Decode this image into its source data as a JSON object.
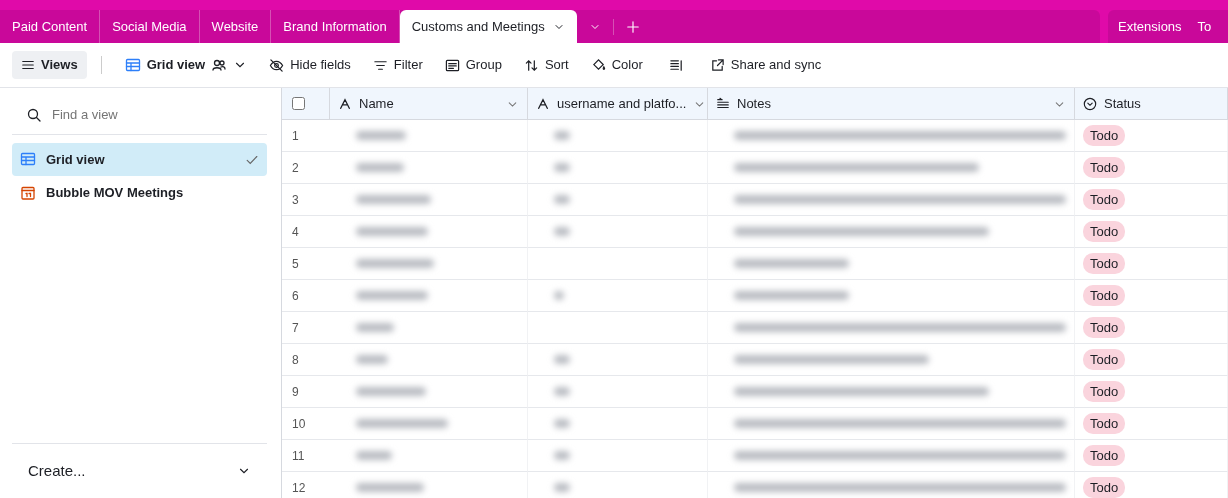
{
  "tabs": [
    {
      "label": "Paid Content",
      "selected": false
    },
    {
      "label": "Social Media",
      "selected": false
    },
    {
      "label": "Website",
      "selected": false
    },
    {
      "label": "Brand Information",
      "selected": false
    },
    {
      "label": "Customs and Meetings",
      "selected": true
    }
  ],
  "top_right": [
    "Extensions",
    "To"
  ],
  "toolbar": {
    "views": "Views",
    "view_name": "Grid view",
    "buttons": [
      {
        "kind": "hide",
        "label": "Hide fields"
      },
      {
        "kind": "filter",
        "label": "Filter"
      },
      {
        "kind": "group",
        "label": "Group"
      },
      {
        "kind": "sort",
        "label": "Sort"
      },
      {
        "kind": "color",
        "label": "Color"
      },
      {
        "kind": "rowheight"
      },
      {
        "kind": "share",
        "label": "Share and sync"
      }
    ]
  },
  "sidebar": {
    "search": {
      "placeholder": "Find a view"
    },
    "items": [
      {
        "kind": "grid",
        "label": "Grid view",
        "selected": true
      },
      {
        "kind": "calendar",
        "label": "Bubble MOV Meetings",
        "selected": false
      }
    ],
    "create": "Create..."
  },
  "table": {
    "select_all": {
      "checked": false
    },
    "columns": [
      {
        "kind": "text",
        "label": "Name"
      },
      {
        "kind": "text",
        "label": "username and platfo..."
      },
      {
        "kind": "longtext",
        "label": "Notes"
      },
      {
        "kind": "select",
        "label": "Status"
      }
    ],
    "rows": [
      {
        "number": "1",
        "name_blurred": true,
        "username_blurred": true,
        "notes_blurred": true,
        "status": "Todo"
      },
      {
        "number": "2",
        "name_blurred": true,
        "username_blurred": true,
        "notes_blurred": true,
        "status": "Todo"
      },
      {
        "number": "3",
        "name_blurred": true,
        "username_blurred": true,
        "notes_blurred": true,
        "status": "Todo"
      },
      {
        "number": "4",
        "name_blurred": true,
        "username_blurred": true,
        "notes_blurred": true,
        "status": "Todo"
      },
      {
        "number": "5",
        "name_blurred": true,
        "username_blurred": false,
        "notes_blurred": true,
        "status": "Todo"
      },
      {
        "number": "6",
        "name_blurred": true,
        "username_blurred": true,
        "notes_blurred": true,
        "status": "Todo"
      },
      {
        "number": "7",
        "name_blurred": true,
        "username_blurred": false,
        "notes_blurred": true,
        "status": "Todo"
      },
      {
        "number": "8",
        "name_blurred": true,
        "username_blurred": true,
        "notes_blurred": true,
        "status": "Todo"
      },
      {
        "number": "9",
        "name_blurred": true,
        "username_blurred": true,
        "notes_blurred": true,
        "status": "Todo"
      },
      {
        "number": "10",
        "name_blurred": true,
        "username_blurred": true,
        "notes_blurred": true,
        "status": "Todo"
      },
      {
        "number": "11",
        "name_blurred": true,
        "username_blurred": true,
        "notes_blurred": true,
        "status": "Todo"
      },
      {
        "number": "12",
        "name_blurred": true,
        "username_blurred": true,
        "notes_blurred": true,
        "status": "Todo"
      }
    ]
  }
}
